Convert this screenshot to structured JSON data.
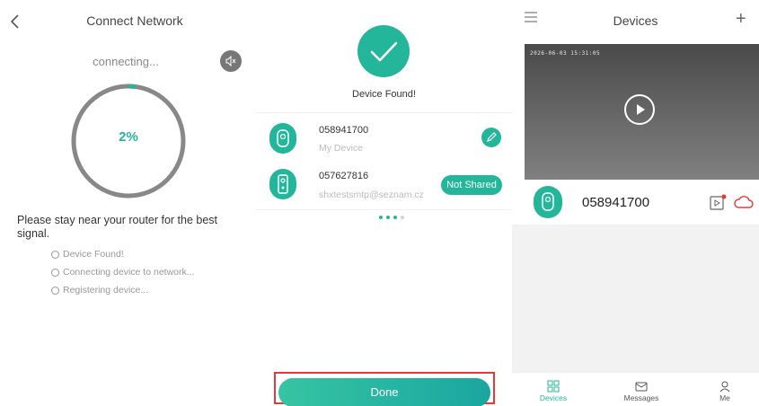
{
  "connect": {
    "title": "Connect Network",
    "status": "connecting...",
    "progress_label": "2%",
    "progress_fraction": 0.02,
    "tip": "Please stay near your router for the best signal.",
    "steps": [
      "Device Found!",
      "Connecting device to network...",
      "Registering device..."
    ]
  },
  "found": {
    "title": "Device Found!",
    "devices": [
      {
        "id": "058941700",
        "subtitle": "My Device"
      },
      {
        "id": "057627816",
        "subtitle": "shxtestsmtp@seznam.cz",
        "badge": "Not Shared"
      }
    ],
    "done_label": "Done"
  },
  "devices": {
    "title": "Devices",
    "timestamp": "2026-06-03 15:31:05",
    "device_name": "058941700",
    "tabs": [
      "Devices",
      "Messages",
      "Me"
    ],
    "active_tab": "Devices"
  },
  "colors": {
    "accent": "#23b69a",
    "alert": "#e53935"
  }
}
